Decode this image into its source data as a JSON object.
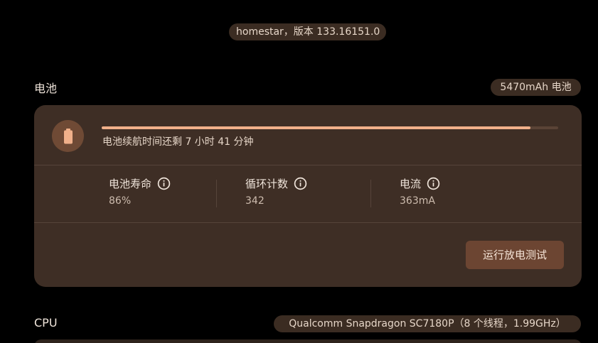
{
  "header": {
    "version_text": "homestar，版本 133.16151.0"
  },
  "battery": {
    "section_title": "电池",
    "capacity_chip": "5470mAh 电池",
    "charge_fraction": 0.94,
    "remaining_text": "电池续航时间还剩 7 小时 41 分钟",
    "metrics": [
      {
        "label": "电池寿命",
        "value": "86%"
      },
      {
        "label": "循环计数",
        "value": "342"
      },
      {
        "label": "电流",
        "value": "363mA"
      }
    ],
    "run_test_label": "运行放电测试",
    "icon": "battery-icon",
    "info_icon": "info-icon"
  },
  "cpu": {
    "section_title": "CPU",
    "processor_chip": "Qualcomm Snapdragon SC7180P（8 个线程，1.99GHz）"
  },
  "colors": {
    "background": "#000000",
    "card": "#3e2e25",
    "accent": "#f1b08a",
    "button": "#6c4532",
    "chip": "#3b2c22"
  }
}
